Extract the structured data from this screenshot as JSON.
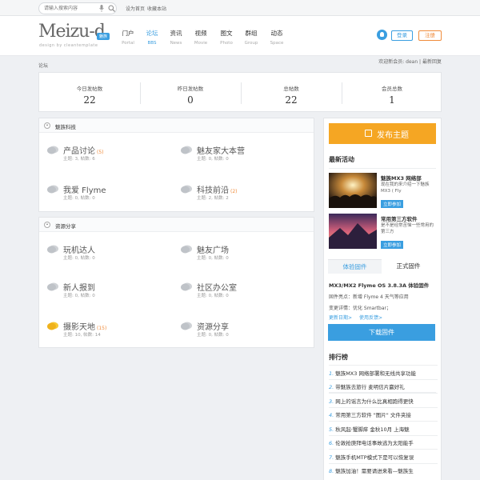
{
  "topbar": {
    "search_placeholder": "请输入搜索内容",
    "link_home": "设为首页",
    "link_fav": "收藏本站"
  },
  "header": {
    "logo": "Meizu-d",
    "logo_badge": "魅族",
    "logo_sub": "design by cleantemplate",
    "nav": [
      {
        "cn": "门户",
        "en": "Portal"
      },
      {
        "cn": "论坛",
        "en": "BBS"
      },
      {
        "cn": "资讯",
        "en": "News"
      },
      {
        "cn": "视频",
        "en": "Movie"
      },
      {
        "cn": "图文",
        "en": "Photo"
      },
      {
        "cn": "群组",
        "en": "Group"
      },
      {
        "cn": "动态",
        "en": "Space"
      }
    ],
    "login": "登录",
    "register": "注册"
  },
  "crumb": "论坛",
  "welcome": {
    "prefix": "欢迎新会员: ",
    "user": "dean",
    "sep": " | ",
    "latest": "最新回复"
  },
  "stats": [
    {
      "label": "今日发帖数",
      "value": "22"
    },
    {
      "label": "昨日发帖数",
      "value": "0"
    },
    {
      "label": "总帖数",
      "value": "22"
    },
    {
      "label": "会员总数",
      "value": "1"
    }
  ],
  "sections": [
    {
      "title": "魅族科技",
      "forums": [
        {
          "name": "产品讨论",
          "count": "(5)",
          "meta": "主题: 3, 帖数: 6"
        },
        {
          "name": "魅友家大本营",
          "count": "",
          "meta": "主题: 0, 帖数: 0"
        },
        {
          "name": "我爱 Flyme",
          "count": "",
          "meta": "主题: 0, 帖数: 0"
        },
        {
          "name": "科技前沿",
          "count": "(2)",
          "meta": "主题: 2, 帖数: 2"
        }
      ]
    },
    {
      "title": "资源分享",
      "forums": [
        {
          "name": "玩机达人",
          "count": "",
          "meta": "主题: 0, 帖数: 0"
        },
        {
          "name": "魅友广场",
          "count": "",
          "meta": "主题: 0, 帖数: 0"
        },
        {
          "name": "新人报到",
          "count": "",
          "meta": "主题: 0, 帖数: 0"
        },
        {
          "name": "社区办公室",
          "count": "",
          "meta": "主题: 0, 帖数: 0"
        },
        {
          "name": "摄影天地",
          "count": "(15)",
          "meta": "主题: 10, 帖数: 14"
        },
        {
          "name": "资源分享",
          "count": "",
          "meta": "主题: 0, 帖数: 0"
        }
      ]
    }
  ],
  "sidebar": {
    "post_button": "发布主题",
    "latest_title": "最新活动",
    "activities": [
      {
        "title": "魅族MX3 网络部",
        "desc": "现在我的来介绍一下魅族MX3 ( Fly",
        "join": "立即参加"
      },
      {
        "title": "常用第三方软件",
        "desc": "是不是经常苦恼一些常用的第三方",
        "join": "立即参加"
      }
    ],
    "tabs": [
      "体验固件",
      "正式固件"
    ],
    "firmware": {
      "title": "MX3/MX2 Flyme OS 3.8.3A 体验固件",
      "line1": "固件亮点：新增 Flyme 4 天气等应用",
      "line2": "变更详情：优化 Smartbar；",
      "link1": "更新日期>",
      "link2": "使用反馈>",
      "download": "下载固件"
    },
    "rank_title": "排行榜",
    "rank": [
      "魅族MX3 网络部署和无线共享功能",
      "带魅族去旅行 麦明信片赢好礼",
      "网上的谣言为什么比真相跑得更快",
      "常用第三方软件 \"图片\" 文件夹接",
      "秋风起·蟹脚痒 金秋10月 上海魅",
      "伦敦抢庚拜电话事故逃为太阳能手",
      "魅族手机MTP模式下是可以恢复误",
      "魅族加油！需要请进来看—魅族生"
    ]
  },
  "colors": {
    "accent": "#3a9ee0",
    "orange": "#f5a623",
    "register": "#f08c3c"
  }
}
